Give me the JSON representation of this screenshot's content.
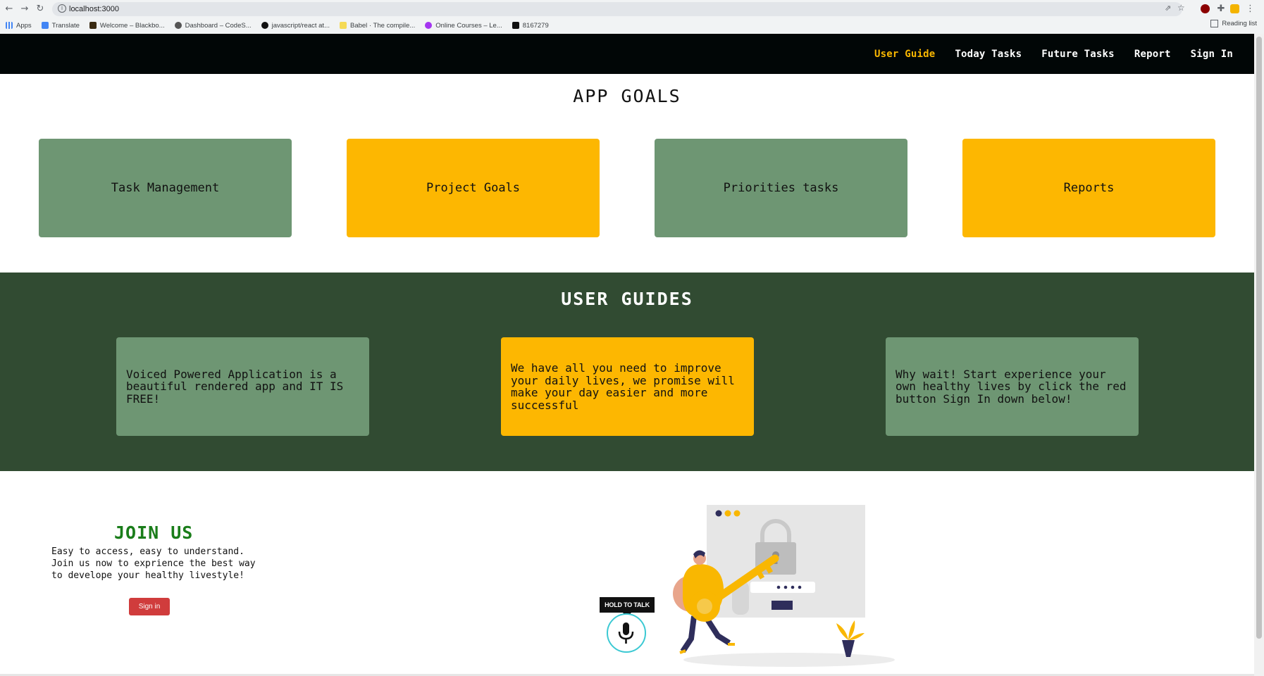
{
  "browser": {
    "url": "localhost:3000",
    "bookmarks": [
      {
        "label": "Apps",
        "color": "#4285f4"
      },
      {
        "label": "Translate",
        "color": "#4285f4"
      },
      {
        "label": "Welcome – Blackbo...",
        "color": "#3a2a12"
      },
      {
        "label": "Dashboard – CodeS...",
        "color": "#555555"
      },
      {
        "label": "javascript/react at...",
        "color": "#111111"
      },
      {
        "label": "Babel · The compile...",
        "color": "#f5da55"
      },
      {
        "label": "Online Courses – Le...",
        "color": "#a435f0"
      },
      {
        "label": "8167279",
        "color": "#111111"
      }
    ],
    "reading_list": "Reading list"
  },
  "nav": {
    "items": [
      {
        "label": "User Guide",
        "active": true
      },
      {
        "label": "Today Tasks",
        "active": false
      },
      {
        "label": "Future Tasks",
        "active": false
      },
      {
        "label": "Report",
        "active": false
      },
      {
        "label": "Sign In",
        "active": false
      }
    ]
  },
  "goals": {
    "title": "APP GOALS",
    "cards": [
      {
        "label": "Task Management",
        "color": "#6e9673"
      },
      {
        "label": "Project Goals",
        "color": "#fdb701"
      },
      {
        "label": "Priorities tasks",
        "color": "#6e9673"
      },
      {
        "label": "Reports",
        "color": "#fdb701"
      }
    ]
  },
  "guides": {
    "title": "USER GUIDES",
    "background": "#314b32",
    "cards": [
      {
        "text": "Voiced Powered Application is a beautiful rendered app and IT IS FREE!",
        "color": "#6e9673"
      },
      {
        "text": "We have all you need to improve your daily lives, we promise will make your day easier and more successful",
        "color": "#fdb701"
      },
      {
        "text": "Why wait! Start experience your own healthy lives by click the red button Sign In down below!",
        "color": "#6e9673"
      }
    ]
  },
  "join": {
    "title": "JOIN US",
    "text_lines": [
      "Easy to access, easy to understand.",
      "Join us now to exprience the best way",
      "to develope your healthy livestyle!"
    ],
    "signin_label": "Sign in",
    "hold_to_talk": "HOLD TO TALK",
    "illustration_icon": "person-with-key-unlocking-icon"
  },
  "colors": {
    "nav_bg": "#010606",
    "accent_active": "#f9b701",
    "title_green": "#1a7d1a",
    "button_red": "#d03c3c",
    "mic_ring": "#3cc9d3"
  }
}
